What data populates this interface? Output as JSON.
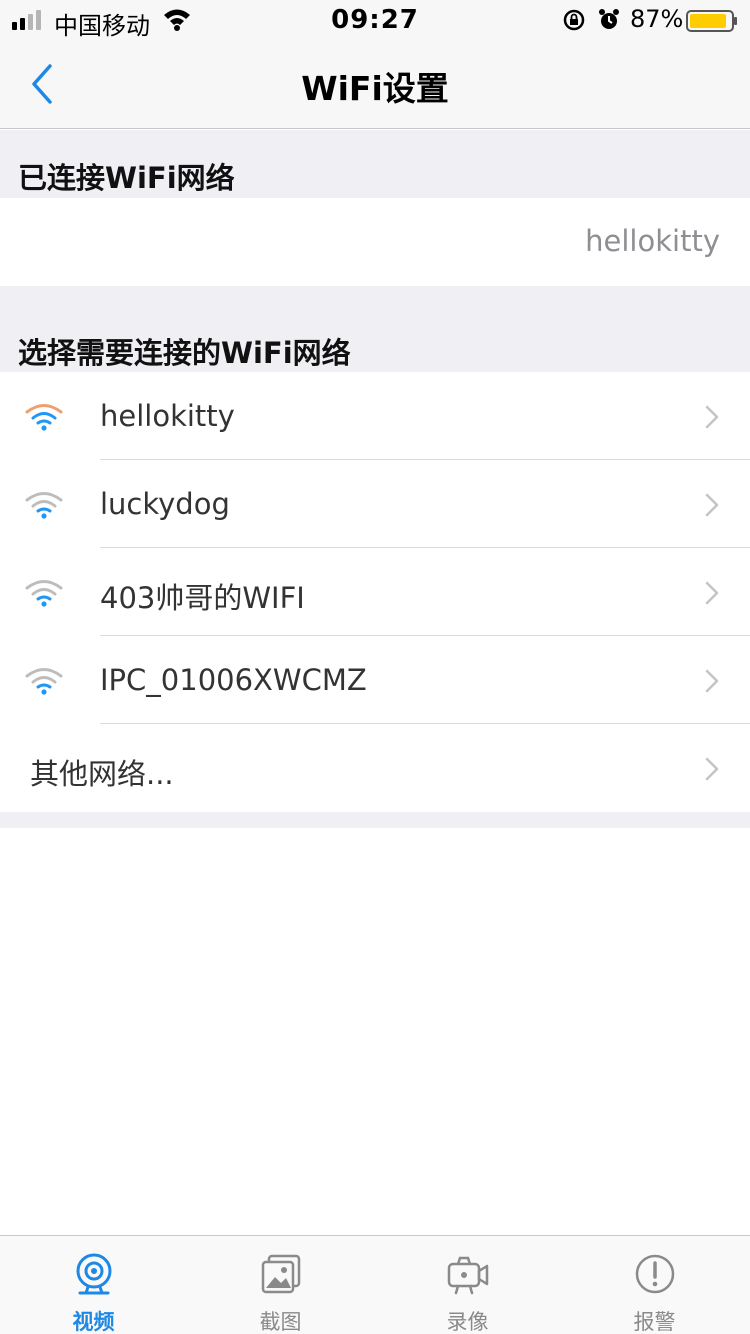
{
  "status_bar": {
    "carrier": "中国移动",
    "time": "09:27",
    "battery_percent": "87%"
  },
  "nav": {
    "title": "WiFi设置"
  },
  "connected_section": {
    "header": "已连接WiFi网络",
    "ssid": "hellokitty"
  },
  "choose_section": {
    "header": "选择需要连接的WiFi网络",
    "networks": [
      {
        "ssid": "hellokitty"
      },
      {
        "ssid": "luckydog"
      },
      {
        "ssid": "403帅哥的WIFI"
      },
      {
        "ssid": "IPC_01006XWCMZ"
      }
    ],
    "other": "其他网络..."
  },
  "tabs": [
    {
      "label": "视频",
      "icon": "camera-icon",
      "active": true
    },
    {
      "label": "截图",
      "icon": "gallery-icon",
      "active": false
    },
    {
      "label": "录像",
      "icon": "video-camera-icon",
      "active": false
    },
    {
      "label": "报警",
      "icon": "alert-icon",
      "active": false
    }
  ],
  "colors": {
    "accent": "#1e88e5",
    "wifi_strong": "#2196f3",
    "wifi_weak": "#bdbdbd",
    "wifi_orange": "#f0a070",
    "section_bg": "#efeff4"
  }
}
